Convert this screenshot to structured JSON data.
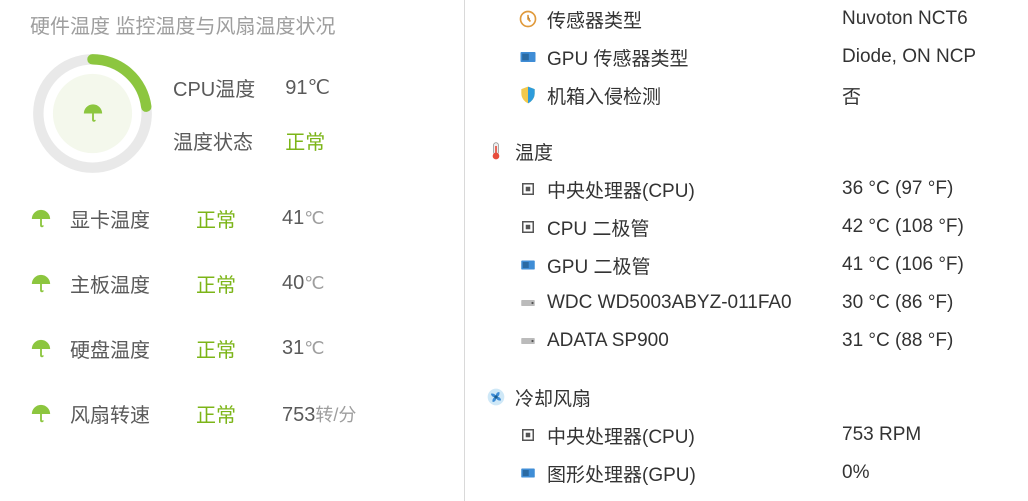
{
  "left": {
    "header": "硬件温度   监控温度与风扇温度状况",
    "gauge": {
      "cpu_label": "CPU温度",
      "cpu_value": "91℃",
      "status_label": "温度状态",
      "status_value": "正常"
    },
    "rows": [
      {
        "label": "显卡温度",
        "status": "正常",
        "value": "41",
        "unit": "℃"
      },
      {
        "label": "主板温度",
        "status": "正常",
        "value": "40",
        "unit": "℃"
      },
      {
        "label": "硬盘温度",
        "status": "正常",
        "value": "31",
        "unit": "℃"
      },
      {
        "label": "风扇转速",
        "status": "正常",
        "value": "753",
        "unit": "转/分"
      }
    ]
  },
  "right": {
    "top": [
      {
        "icon": "clock",
        "label": "传感器类型",
        "value": "Nuvoton NCT6"
      },
      {
        "icon": "gpu",
        "label": "GPU 传感器类型",
        "value": "Diode, ON NCP"
      },
      {
        "icon": "shield",
        "label": "机箱入侵检测",
        "value": "否"
      }
    ],
    "temp_section": {
      "icon": "thermometer",
      "label": "温度"
    },
    "temps": [
      {
        "icon": "chip",
        "label": "中央处理器(CPU)",
        "value": "36 °C  (97 °F)"
      },
      {
        "icon": "chip",
        "label": "CPU 二极管",
        "value": "42 °C  (108 °F)"
      },
      {
        "icon": "gpu",
        "label": "GPU 二极管",
        "value": "41 °C  (106 °F)"
      },
      {
        "icon": "drive",
        "label": "WDC WD5003ABYZ-011FA0",
        "value": "30 °C  (86 °F)"
      },
      {
        "icon": "drive",
        "label": "ADATA SP900",
        "value": "31 °C  (88 °F)"
      }
    ],
    "fan_section": {
      "icon": "fan",
      "label": "冷却风扇"
    },
    "fans": [
      {
        "icon": "chip",
        "label": "中央处理器(CPU)",
        "value": "753 RPM"
      },
      {
        "icon": "gpu",
        "label": "图形处理器(GPU)",
        "value": "0%"
      }
    ]
  }
}
